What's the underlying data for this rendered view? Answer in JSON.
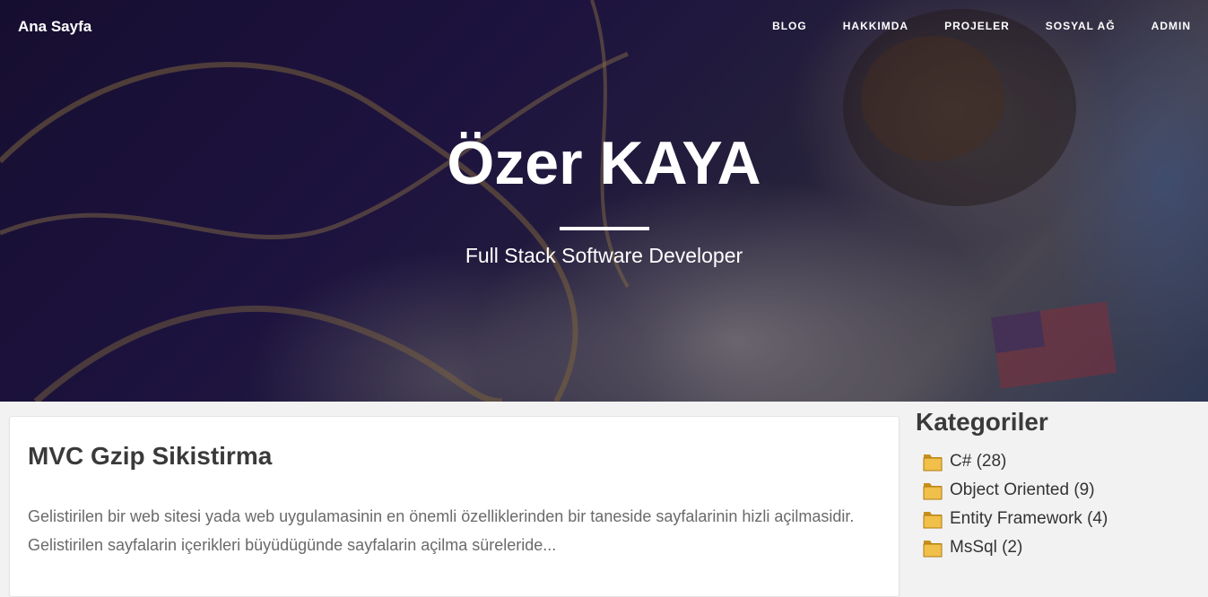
{
  "header": {
    "brand": "Ana Sayfa",
    "nav": [
      "BLOG",
      "HAKKIMDA",
      "PROJELER",
      "SOSYAL AĞ",
      "ADMIN"
    ]
  },
  "hero": {
    "title": "Özer KAYA",
    "subtitle": "Full Stack Software Developer"
  },
  "post": {
    "title": "MVC Gzip Sikistirma",
    "excerpt": "Gelistirilen bir web sitesi yada web uygulamasinin en önemli özelliklerinden bir taneside sayfalarinin hizli açilmasidir. Gelistirilen sayfalarin içerikleri büyüdügünde sayfalarin açilma süreleride..."
  },
  "sidebar": {
    "title": "Kategoriler",
    "categories": [
      {
        "label": "C# (28)",
        "icon": "folder-icon"
      },
      {
        "label": "Object Oriented (9)",
        "icon": "folder-icon"
      },
      {
        "label": "Entity Framework (4)",
        "icon": "folder-icon"
      },
      {
        "label": "MsSql (2)",
        "icon": "folder-icon"
      }
    ]
  },
  "colors": {
    "hero_text": "#ffffff",
    "heading": "#3a3a3a",
    "body_text": "#6a6a6a",
    "folder": "#e8b838"
  }
}
